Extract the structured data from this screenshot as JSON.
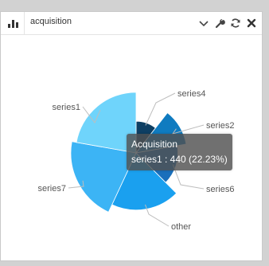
{
  "window": {
    "title": "acquisition",
    "tools": [
      "chevron-down-icon",
      "wrench-icon",
      "refresh-icon",
      "close-icon"
    ]
  },
  "chart_data": {
    "type": "pie",
    "subtype": "rose",
    "categories": [
      "series1",
      "series2",
      "series4",
      "series6",
      "other",
      "series7"
    ],
    "values": [
      440,
      310,
      120,
      210,
      390,
      510
    ],
    "colors": [
      "#6fd4fb",
      "#0f7bc0",
      "#0e3f63",
      "#1a6fbb",
      "#1aa0ef",
      "#3cb4f5"
    ],
    "labels_shown": [
      "series4",
      "series2",
      "series6",
      "other",
      "series7",
      "series1"
    ],
    "legend": "none"
  },
  "tooltip": {
    "title": "Acquisition",
    "text": "series1 : 440 (22.23%)"
  }
}
